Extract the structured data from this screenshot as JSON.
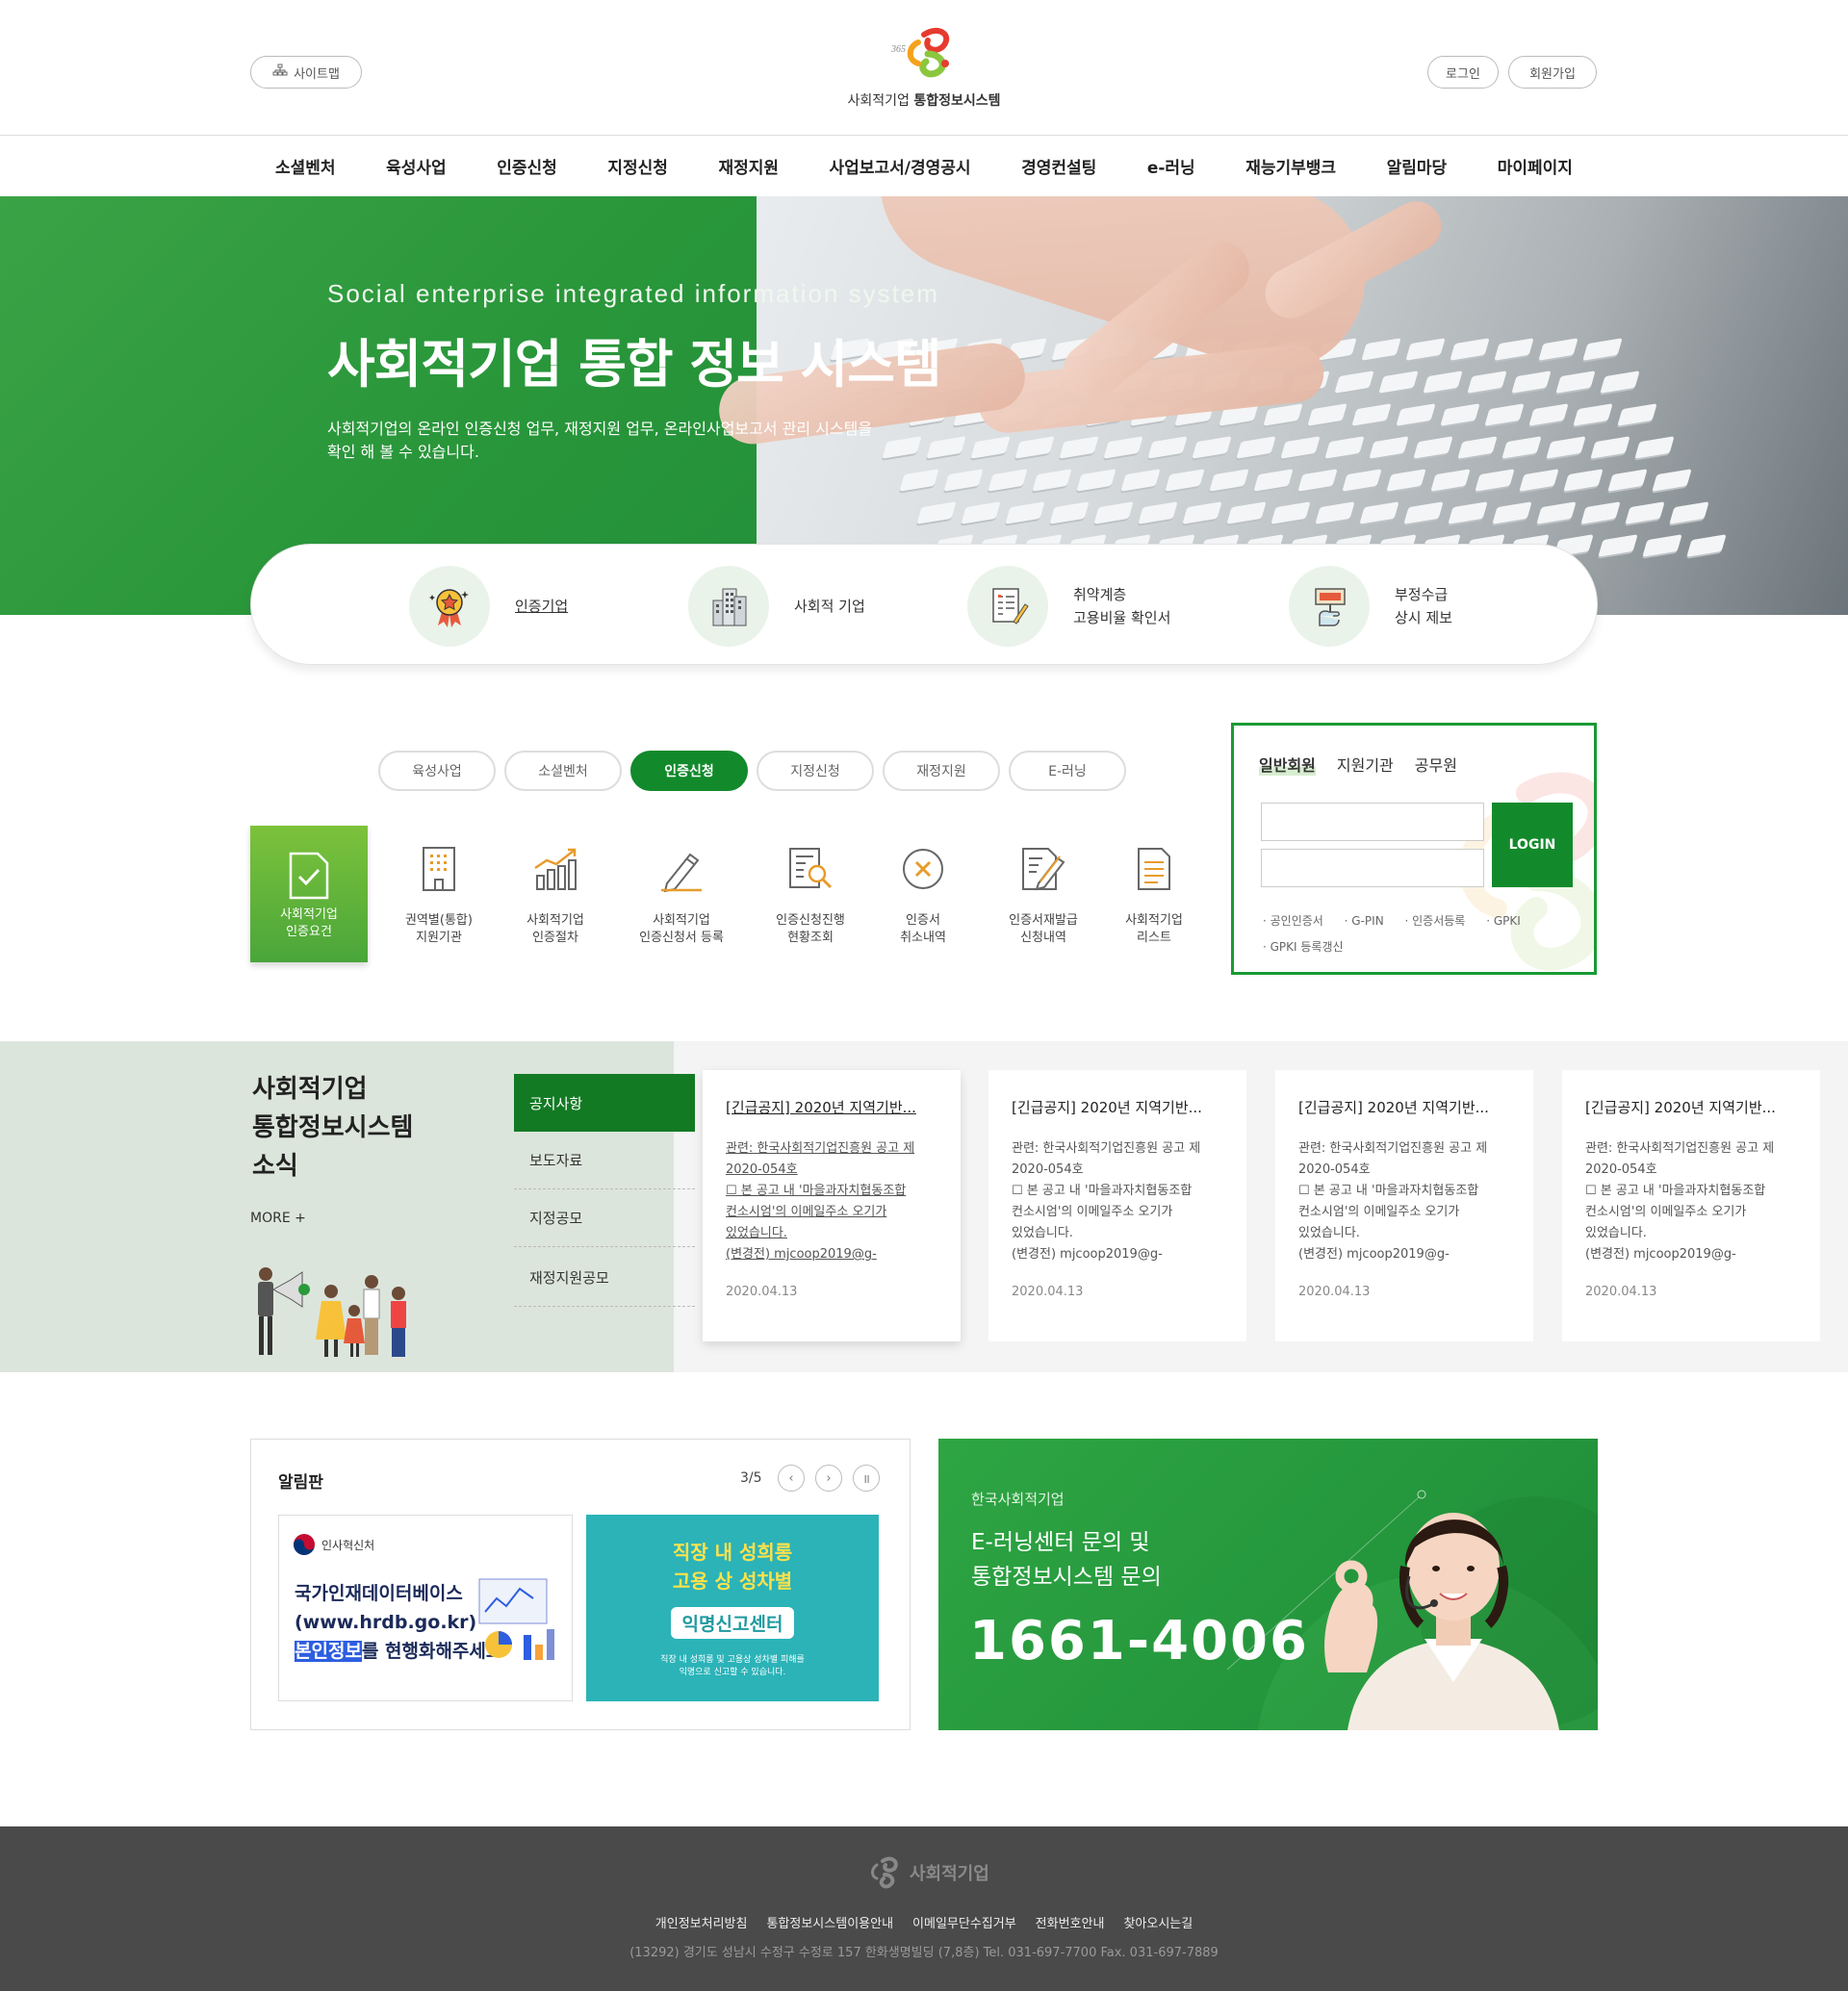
{
  "header": {
    "sitemap_label": "사이트맵",
    "login_label": "로그인",
    "join_label": "회원가입",
    "logo_text_prefix": "사회적기업",
    "logo_text_bold": "통합정보시스템"
  },
  "gnb": [
    "소셜벤처",
    "육성사업",
    "인증신청",
    "지정신청",
    "재정지원",
    "사업보고서/경영공시",
    "경영컨설팅",
    "e-러닝",
    "재능기부뱅크",
    "알림마당",
    "마이페이지"
  ],
  "hero": {
    "subtitle": "Social enterprise integrated information system",
    "title": "사회적기업 통합 정보 시스템",
    "desc_line1": "사회적기업의 온라인 인증신청 업무, 재정지원 업무, 온라인사업보고서 관리 시스템을",
    "desc_line2": "확인 해 볼 수 있습니다."
  },
  "quick": [
    {
      "line1": "인증기업",
      "line2": ""
    },
    {
      "line1": "사회적 기업",
      "line2": ""
    },
    {
      "line1": "취약계층",
      "line2": "고용비율 확인서"
    },
    {
      "line1": "부정수급",
      "line2": "상시 제보"
    }
  ],
  "tabs": [
    "육성사업",
    "소셜벤처",
    "인증신청",
    "지정신청",
    "재정지원",
    "E-러닝"
  ],
  "services": [
    {
      "line1": "사회적기업",
      "line2": "인증요건"
    },
    {
      "line1": "권역별(통합)",
      "line2": "지원기관"
    },
    {
      "line1": "사회적기업",
      "line2": "인증절차"
    },
    {
      "line1": "사회적기업",
      "line2": "인증신청서 등록"
    },
    {
      "line1": "인증신청진행",
      "line2": "현황조회"
    },
    {
      "line1": "인증서",
      "line2": "취소내역"
    },
    {
      "line1": "인증서재발급",
      "line2": "신청내역"
    },
    {
      "line1": "사회적기업",
      "line2": "리스트"
    }
  ],
  "login": {
    "tabs": [
      "일반회원",
      "지원기관",
      "공무원"
    ],
    "button": "LOGIN",
    "links": [
      "· 공인인증서",
      "· G-PIN",
      "· 인증서등록",
      "· GPKI",
      "· GPKI 등록갱신"
    ]
  },
  "news": {
    "title_lines": [
      "사회적기업",
      "통합정보시스템",
      "소식"
    ],
    "more": "MORE  +",
    "menu": [
      "공지사항",
      "보도자료",
      "지정공모",
      "재정지원공모"
    ],
    "cards": [
      {
        "title": "[긴급공지] 2020년 지역기반...",
        "body": [
          "관련: 한국사회적기업진흥원 공고 제",
          "2020-054호",
          "☐ 본 공고 내 '마을과자치협동조합",
          "컨소시엄'의 이메일주소 오기가",
          "있었습니다.",
          "(변경전) mjcoop2019@g-"
        ],
        "date": "2020.04.13"
      },
      {
        "title": "[긴급공지] 2020년 지역기반...",
        "body": [
          "관련: 한국사회적기업진흥원 공고 제",
          "2020-054호",
          "☐ 본 공고 내 '마을과자치협동조합",
          "컨소시엄'의 이메일주소 오기가",
          "있었습니다.",
          "(변경전) mjcoop2019@g-"
        ],
        "date": "2020.04.13"
      },
      {
        "title": "[긴급공지] 2020년 지역기반...",
        "body": [
          "관련: 한국사회적기업진흥원 공고 제",
          "2020-054호",
          "☐ 본 공고 내 '마을과자치협동조합",
          "컨소시엄'의 이메일주소 오기가",
          "있었습니다.",
          "(변경전) mjcoop2019@g-"
        ],
        "date": "2020.04.13"
      },
      {
        "title": "[긴급공지] 2020년 지역기반...",
        "body": [
          "관련: 한국사회적기업진흥원 공고 제",
          "2020-054호",
          "☐ 본 공고 내 '마을과자치협동조합",
          "컨소시엄'의 이메일주소 오기가",
          "있었습니다.",
          "(변경전) mjcoop2019@g-"
        ],
        "date": "2020.04.13"
      }
    ]
  },
  "alim": {
    "title": "알림판",
    "page": "3/5",
    "banner1": {
      "org": "인사혁신처",
      "line1": "국가인재데이터베이스",
      "line2": "(www.hrdb.go.kr)",
      "line3_hl": "본인정보",
      "line3_rest": "를 현행화해주세요"
    },
    "banner2": {
      "line1": "직장 내 성희롱",
      "line2": "고용 상 성차별",
      "line3": "익명신고센터",
      "small1": "직장 내 성희롱 및 고용상 성차별 피해를",
      "small2": "익명으로 신고할 수 있습니다."
    }
  },
  "cs": {
    "org": "한국사회적기업",
    "line1": "E-러닝센터 문의 및",
    "line2": "통합정보시스템 문의",
    "phone": "1661-4006"
  },
  "footer": {
    "logo": "사회적기업",
    "links": [
      "개인정보처리방침",
      "통합정보시스템이용안내",
      "이메일무단수집거부",
      "전화번호안내",
      "찾아오시는길"
    ],
    "address": "(13292) 경기도 성남시 수정구 수정로 157 한화생명빌딩 (7,8층) Tel. 031-697-7700 Fax. 031-697-7889"
  },
  "colors": {
    "primary": "#128a2b",
    "hero_green": "#2a9a3c",
    "footer": "#4a4a4a"
  }
}
